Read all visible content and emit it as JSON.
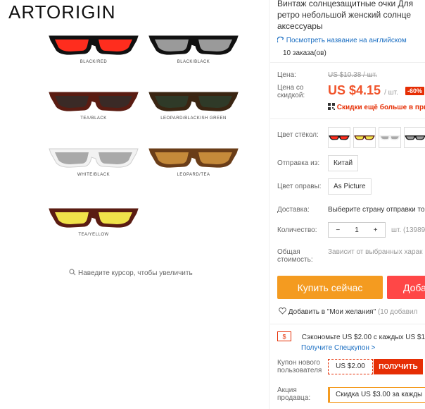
{
  "brand": "ARTORIGIN",
  "gallery": {
    "variants": [
      {
        "caption": "BLACK/RED",
        "frame": "#111111",
        "lens": "#ff2d1e"
      },
      {
        "caption": "BLACK/BLACK",
        "frame": "#111111",
        "lens": "#9a9a9a"
      },
      {
        "caption": "TEA/BLACK",
        "frame": "#5a1c12",
        "lens": "#3a2a26"
      },
      {
        "caption": "LEOPARD/BLACKISH GREEN",
        "frame": "#3a2512",
        "lens": "#2f3a28"
      },
      {
        "caption": "WHITE/BLACK",
        "frame": "#f2f2f2",
        "lens": "#a9a9a9"
      },
      {
        "caption": "LEOPARD/TEA",
        "frame": "#6a3d18",
        "lens": "#c58a3a"
      },
      {
        "caption": "TEA/YELLOW",
        "frame": "#5a1c12",
        "lens": "#f0e24a"
      }
    ],
    "zoom_hint": "Наведите курсор, чтобы увеличить"
  },
  "product": {
    "title_lines": [
      "Винтаж солнцезащитные очки Для",
      "ретро небольшой женский солнце",
      "аксессуары"
    ],
    "translate_link": "Посмотреть название на английском",
    "orders": "10 заказа(ов)"
  },
  "price": {
    "label": "Цена:",
    "old": "US $10.38 / шт.",
    "discount_label": "Цена со скидкой:",
    "new": "US $4.15",
    "unit": "/ шт.",
    "discount": "-60%",
    "more": "Скидки ещё больше в при"
  },
  "options": {
    "lens_color_label": "Цвет стёкол:",
    "lens_swatches": [
      {
        "lens": "#ff2d1e",
        "frame": "#111111"
      },
      {
        "lens": "#f0e24a",
        "frame": "#5a1c12"
      },
      {
        "lens": "#a9a9a9",
        "frame": "#f2f2f2"
      },
      {
        "lens": "#9a9a9a",
        "frame": "#111111"
      }
    ],
    "ship_from_label": "Отправка из:",
    "ship_from_value": "Китай",
    "frame_color_label": "Цвет оправы:",
    "frame_color_value": "As Picture",
    "delivery_label": "Доставка:",
    "delivery_value": "Выберите страну отправки то",
    "qty_label": "Количество:",
    "qty_value": "1",
    "qty_minus": "−",
    "qty_plus": "+",
    "stock": "шт. (13989",
    "total_label": "Общая стоимость:",
    "total_value": "Зависит от выбранных харак"
  },
  "actions": {
    "buy": "Купить сейчас",
    "cart": "Доба",
    "wishlist": "Добавить в \"Мои желания\"",
    "wishlist_count": "(10 добавил"
  },
  "coupons": {
    "save_text": "Сэкономьте US $2.00 с каждых US $1",
    "special_link": "Получите Спецкупон >",
    "new_user_label": "Купон нового пользователя",
    "new_user_value": "US $2.00",
    "get_button": "ПОЛУЧИТЬ",
    "seller_promo_label": "Акция продавца:",
    "seller_promo_value": "Скидка US $3.00 за кажды"
  },
  "colors": {
    "accent": "#f0532a",
    "buy_button": "#f49b20",
    "cart_button": "#ff4747",
    "link": "#1a6ec2"
  }
}
